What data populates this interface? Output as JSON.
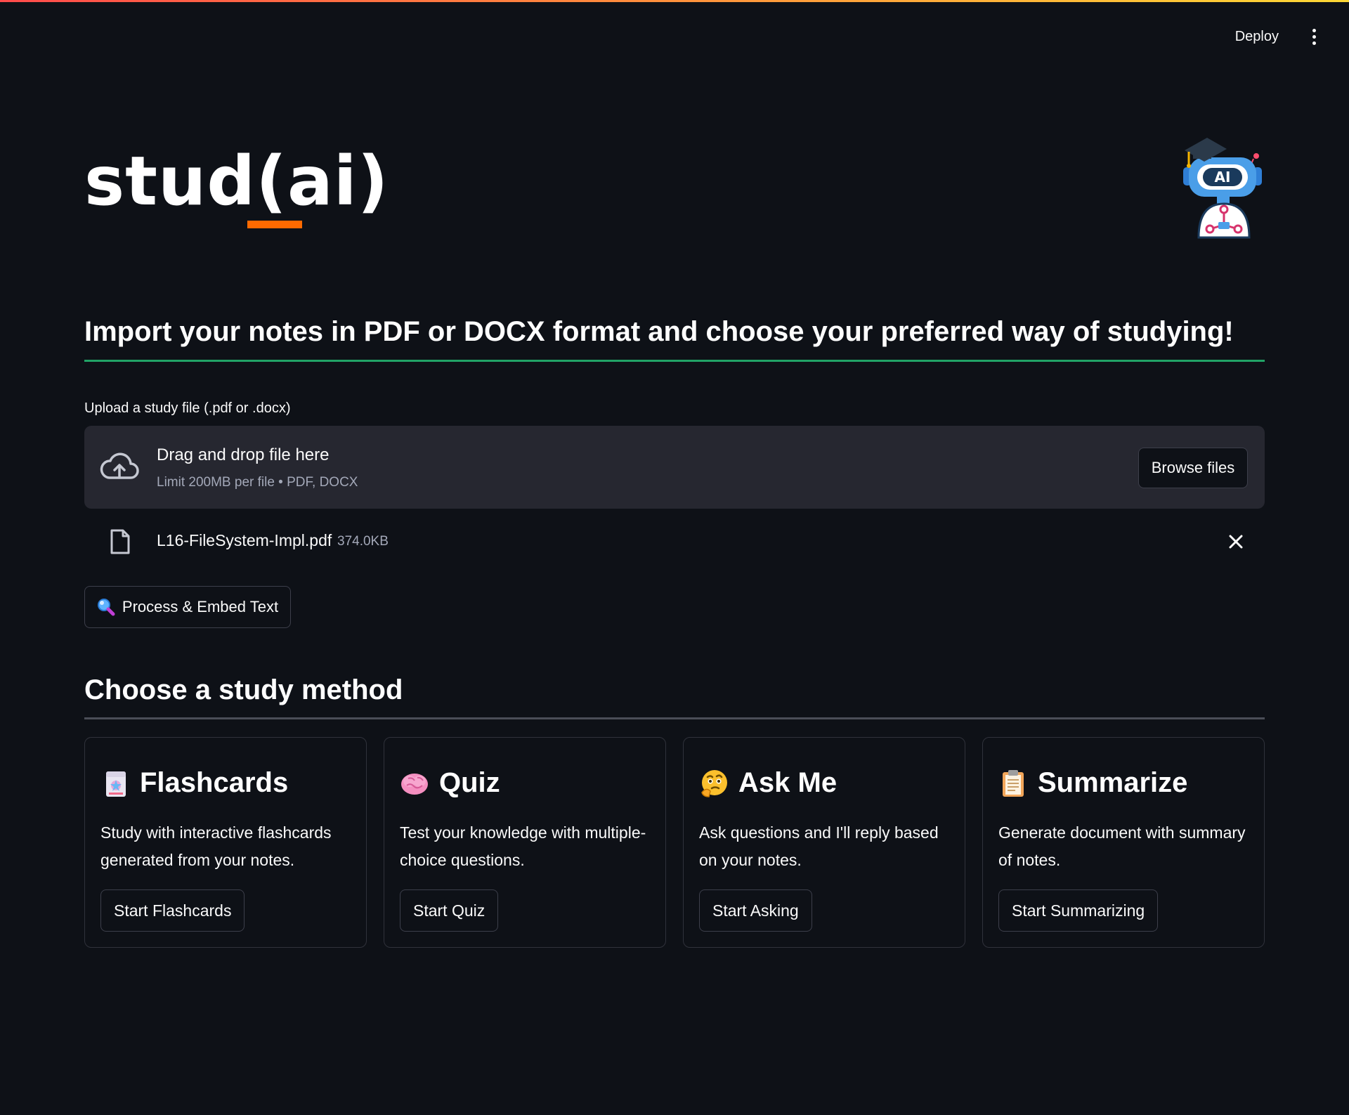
{
  "header": {
    "deploy_label": "Deploy"
  },
  "logo": {
    "text": "stud(ai)",
    "accent_color": "#ff6a00"
  },
  "import_heading": "Import your notes in PDF or DOCX format and choose your preferred way of studying!",
  "uploader": {
    "label": "Upload a study file (.pdf or .docx)",
    "drop_title": "Drag and drop file here",
    "drop_subtitle": "Limit 200MB per file • PDF, DOCX",
    "browse_label": "Browse files",
    "icon": "cloud-upload-icon"
  },
  "uploaded_file": {
    "name": "L16-FileSystem-Impl.pdf",
    "size": "374.0KB",
    "icon": "file-icon"
  },
  "process_button": {
    "label": "Process & Embed Text",
    "icon": "magnifier-icon"
  },
  "study_heading": "Choose a study method",
  "cards": [
    {
      "icon": "flashcard-icon",
      "title": "Flashcards",
      "description": "Study with interactive flashcards generated from your notes.",
      "button": "Start Flashcards"
    },
    {
      "icon": "brain-icon",
      "title": "Quiz",
      "description": "Test your knowledge with multiple-choice questions.",
      "button": "Start Quiz"
    },
    {
      "icon": "thinking-face-icon",
      "title": "Ask Me",
      "description": "Ask questions and I'll reply based on your notes.",
      "button": "Start Asking"
    },
    {
      "icon": "clipboard-icon",
      "title": "Summarize",
      "description": "Generate document with summary of notes.",
      "button": "Start Summarizing"
    }
  ],
  "colors": {
    "background": "#0e1117",
    "surface": "#262730",
    "heading_rule": "#21a366",
    "section_rule": "#4a4d57"
  }
}
